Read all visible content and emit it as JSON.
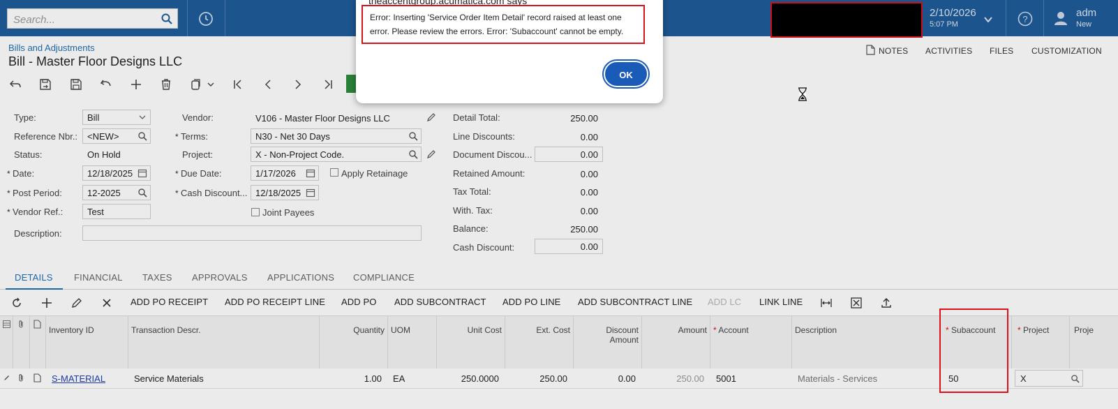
{
  "topbar": {
    "search_placeholder": "Search...",
    "date": "2/10/2026",
    "time": "5:07 PM",
    "user_line1": "adm",
    "user_line2": "New"
  },
  "header": {
    "breadcrumb": "Bills and Adjustments",
    "title": "Bill - Master Floor Designs LLC",
    "links": {
      "notes": "NOTES",
      "activities": "ACTIVITIES",
      "files": "FILES",
      "customization": "CUSTOMIZATION"
    }
  },
  "form": {
    "type_label": "Type:",
    "type_value": "Bill",
    "ref_label": "Reference Nbr.:",
    "ref_value": "<NEW>",
    "status_label": "Status:",
    "status_value": "On Hold",
    "date_label": "Date:",
    "date_value": "12/18/2025",
    "post_period_label": "Post Period:",
    "post_period_value": "12-2025",
    "vendor_ref_label": "Vendor Ref.:",
    "vendor_ref_value": "Test",
    "description_label": "Description:",
    "vendor_label": "Vendor:",
    "vendor_value": "V106 - Master Floor Designs LLC",
    "terms_label": "Terms:",
    "terms_value": "N30 - Net 30 Days",
    "project_label": "Project:",
    "project_value": "X - Non-Project Code.",
    "due_date_label": "Due Date:",
    "due_date_value": "1/17/2026",
    "apply_retainage_label": "Apply Retainage",
    "cash_discount_label": "Cash Discount...",
    "cash_discount_value": "12/18/2025",
    "joint_payees_label": "Joint Payees"
  },
  "totals": {
    "detail_total_label": "Detail Total:",
    "detail_total": "250.00",
    "line_discounts_label": "Line Discounts:",
    "line_discounts": "0.00",
    "document_discount_label": "Document Discou...",
    "document_discount": "0.00",
    "retained_amount_label": "Retained Amount:",
    "retained_amount": "0.00",
    "tax_total_label": "Tax Total:",
    "tax_total": "0.00",
    "with_tax_label": "With. Tax:",
    "with_tax": "0.00",
    "balance_label": "Balance:",
    "balance": "250.00",
    "cash_discount_label": "Cash Discount:",
    "cash_discount": "0.00"
  },
  "tabs": [
    "DETAILS",
    "FINANCIAL",
    "TAXES",
    "APPROVALS",
    "APPLICATIONS",
    "COMPLIANCE"
  ],
  "grid_toolbar": {
    "add_po_receipt": "ADD PO RECEIPT",
    "add_po_receipt_line": "ADD PO RECEIPT LINE",
    "add_po": "ADD PO",
    "add_subcontract": "ADD SUBCONTRACT",
    "add_po_line": "ADD PO LINE",
    "add_subcontract_line": "ADD SUBCONTRACT LINE",
    "add_lc": "ADD LC",
    "link_line": "LINK LINE"
  },
  "grid": {
    "headers": {
      "inventory_id": "Inventory ID",
      "transaction_descr": "Transaction Descr.",
      "quantity": "Quantity",
      "uom": "UOM",
      "unit_cost": "Unit Cost",
      "ext_cost": "Ext. Cost",
      "discount_amount_1": "Discount",
      "discount_amount_2": "Amount",
      "amount": "Amount",
      "account": "Account",
      "description": "Description",
      "subaccount": "Subaccount",
      "project": "Project",
      "project_task": "Proje"
    },
    "row": {
      "inventory_id": "S-MATERIAL",
      "transaction_descr": "Service Materials",
      "quantity": "1.00",
      "uom": "EA",
      "unit_cost": "250.0000",
      "ext_cost": "250.00",
      "discount_amount": "0.00",
      "amount": "250.00",
      "account": "5001",
      "description": "Materials - Services",
      "subaccount": "50",
      "project": "X"
    }
  },
  "dialog": {
    "origin": "theaccentgroup.acumatica.com says",
    "message": "Error: Inserting  'Service Order Item Detail' record raised at least one error. Please review the errors. Error: 'Subaccount' cannot be empty.",
    "ok_label": "OK"
  },
  "colors": {
    "topbar": "#1f5c99",
    "accent": "#1f6fb5",
    "highlight_red": "#e0101a",
    "ok_button": "#1a5bb8"
  }
}
